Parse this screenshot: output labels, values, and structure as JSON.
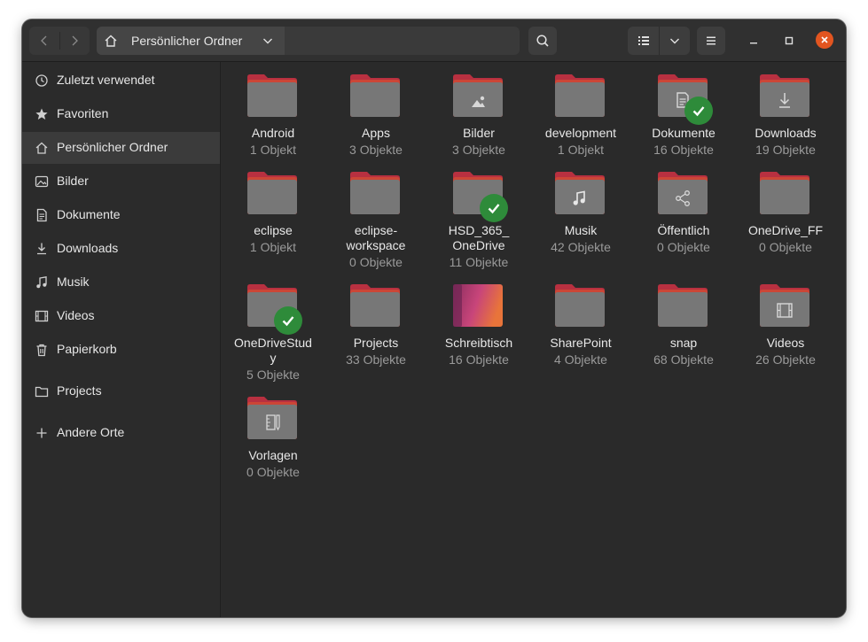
{
  "header": {
    "path_label": "Persönlicher Ordner",
    "icons": [
      "back-icon",
      "forward-icon",
      "home-icon",
      "chevron-down-icon",
      "search-icon",
      "list-view-icon",
      "menu-icon",
      "minimize-icon",
      "maximize-icon",
      "close-icon"
    ]
  },
  "sidebar": {
    "items": [
      {
        "label": "Zuletzt verwendet",
        "icon": "clock-icon"
      },
      {
        "label": "Favoriten",
        "icon": "star-icon"
      },
      {
        "label": "Persönlicher Ordner",
        "icon": "home-icon",
        "active": true
      },
      {
        "label": "Bilder",
        "icon": "picture-icon"
      },
      {
        "label": "Dokumente",
        "icon": "document-icon"
      },
      {
        "label": "Downloads",
        "icon": "download-icon"
      },
      {
        "label": "Musik",
        "icon": "music-icon"
      },
      {
        "label": "Videos",
        "icon": "video-icon"
      },
      {
        "label": "Papierkorb",
        "icon": "trash-icon"
      },
      {
        "label": "Projects",
        "icon": "folder-icon"
      },
      {
        "label": "Andere Orte",
        "icon": "plus-icon"
      }
    ]
  },
  "files": [
    {
      "name": "Android",
      "count": "1 Objekt",
      "emblem": ""
    },
    {
      "name": "Apps",
      "count": "3 Objekte",
      "emblem": ""
    },
    {
      "name": "Bilder",
      "count": "3 Objekte",
      "emblem": "picture"
    },
    {
      "name": "development",
      "count": "1 Objekt",
      "emblem": ""
    },
    {
      "name": "Dokumente",
      "count": "16 Objekte",
      "emblem": "document",
      "synced": true
    },
    {
      "name": "Downloads",
      "count": "19 Objekte",
      "emblem": "download"
    },
    {
      "name": "eclipse",
      "count": "1 Objekt",
      "emblem": ""
    },
    {
      "name": "eclipse-\nworkspace",
      "count": "0 Objekte",
      "emblem": ""
    },
    {
      "name": "HSD_365_\nOneDrive",
      "count": "11 Objekte",
      "emblem": "",
      "synced": true
    },
    {
      "name": "Musik",
      "count": "42 Objekte",
      "emblem": "music"
    },
    {
      "name": "Öffentlich",
      "count": "0 Objekte",
      "emblem": "share"
    },
    {
      "name": "OneDrive_FF",
      "count": "0 Objekte",
      "emblem": ""
    },
    {
      "name": "OneDriveStud\ny",
      "count": "5 Objekte",
      "emblem": "",
      "synced": true
    },
    {
      "name": "Projects",
      "count": "33 Objekte",
      "emblem": ""
    },
    {
      "name": "Schreibtisch",
      "count": "16 Objekte",
      "emblem": "desktop"
    },
    {
      "name": "SharePoint",
      "count": "4 Objekte",
      "emblem": ""
    },
    {
      "name": "snap",
      "count": "68 Objekte",
      "emblem": ""
    },
    {
      "name": "Videos",
      "count": "26 Objekte",
      "emblem": "video"
    },
    {
      "name": "Vorlagen",
      "count": "0 Objekte",
      "emblem": "template"
    }
  ],
  "colors": {
    "folder_tab": "#c0303c",
    "folder_body": "#7a7a7a",
    "sync_badge": "#2e8b3a",
    "close_button": "#e25520"
  }
}
